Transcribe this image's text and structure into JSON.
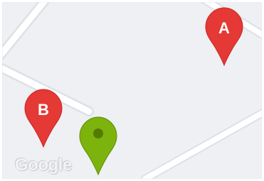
{
  "map": {
    "markers": [
      {
        "id": "a",
        "label": "A",
        "color": "#e53935"
      },
      {
        "id": "b",
        "label": "B",
        "color": "#e53935"
      },
      {
        "id": "current",
        "label": "",
        "color": "#7cb30c"
      }
    ],
    "attribution": "Google"
  }
}
